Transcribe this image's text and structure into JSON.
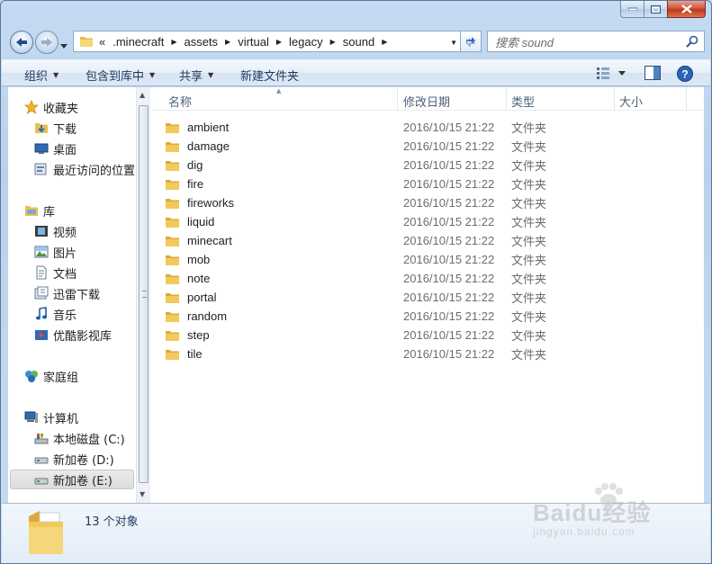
{
  "window": {
    "caption_buttons": [
      "minimize",
      "maximize",
      "close"
    ]
  },
  "address_bar": {
    "overflow_chevron": "«",
    "crumbs": [
      ".minecraft",
      "assets",
      "virtual",
      "legacy",
      "sound"
    ]
  },
  "search": {
    "placeholder": "搜索 sound"
  },
  "toolbar": {
    "organize": "组织",
    "include_in_library": "包含到库中",
    "share": "共享",
    "new_folder": "新建文件夹"
  },
  "nav": {
    "favorites": "收藏夹",
    "downloads": "下载",
    "desktop": "桌面",
    "recent": "最近访问的位置",
    "libraries": "库",
    "videos": "视频",
    "pictures": "图片",
    "documents": "文档",
    "xunlei": "迅雷下载",
    "music": "音乐",
    "youku": "优酷影视库",
    "homegroup": "家庭组",
    "computer": "计算机",
    "drive_c": "本地磁盘 (C:)",
    "drive_d": "新加卷 (D:)",
    "drive_e": "新加卷 (E:)"
  },
  "columns": {
    "name": "名称",
    "date": "修改日期",
    "type": "类型",
    "size": "大小"
  },
  "files": [
    {
      "name": "ambient",
      "date": "2016/10/15 21:22",
      "type": "文件夹"
    },
    {
      "name": "damage",
      "date": "2016/10/15 21:22",
      "type": "文件夹"
    },
    {
      "name": "dig",
      "date": "2016/10/15 21:22",
      "type": "文件夹"
    },
    {
      "name": "fire",
      "date": "2016/10/15 21:22",
      "type": "文件夹"
    },
    {
      "name": "fireworks",
      "date": "2016/10/15 21:22",
      "type": "文件夹"
    },
    {
      "name": "liquid",
      "date": "2016/10/15 21:22",
      "type": "文件夹"
    },
    {
      "name": "minecart",
      "date": "2016/10/15 21:22",
      "type": "文件夹"
    },
    {
      "name": "mob",
      "date": "2016/10/15 21:22",
      "type": "文件夹"
    },
    {
      "name": "note",
      "date": "2016/10/15 21:22",
      "type": "文件夹"
    },
    {
      "name": "portal",
      "date": "2016/10/15 21:22",
      "type": "文件夹"
    },
    {
      "name": "random",
      "date": "2016/10/15 21:22",
      "type": "文件夹"
    },
    {
      "name": "step",
      "date": "2016/10/15 21:22",
      "type": "文件夹"
    },
    {
      "name": "tile",
      "date": "2016/10/15 21:22",
      "type": "文件夹"
    }
  ],
  "status": {
    "count": "13 个对象"
  },
  "watermark": {
    "brand": "Baidu经验",
    "url": "jingyan.baidu.com"
  },
  "colors": {
    "folder": "#f2c95a",
    "accent": "#1e395b"
  }
}
